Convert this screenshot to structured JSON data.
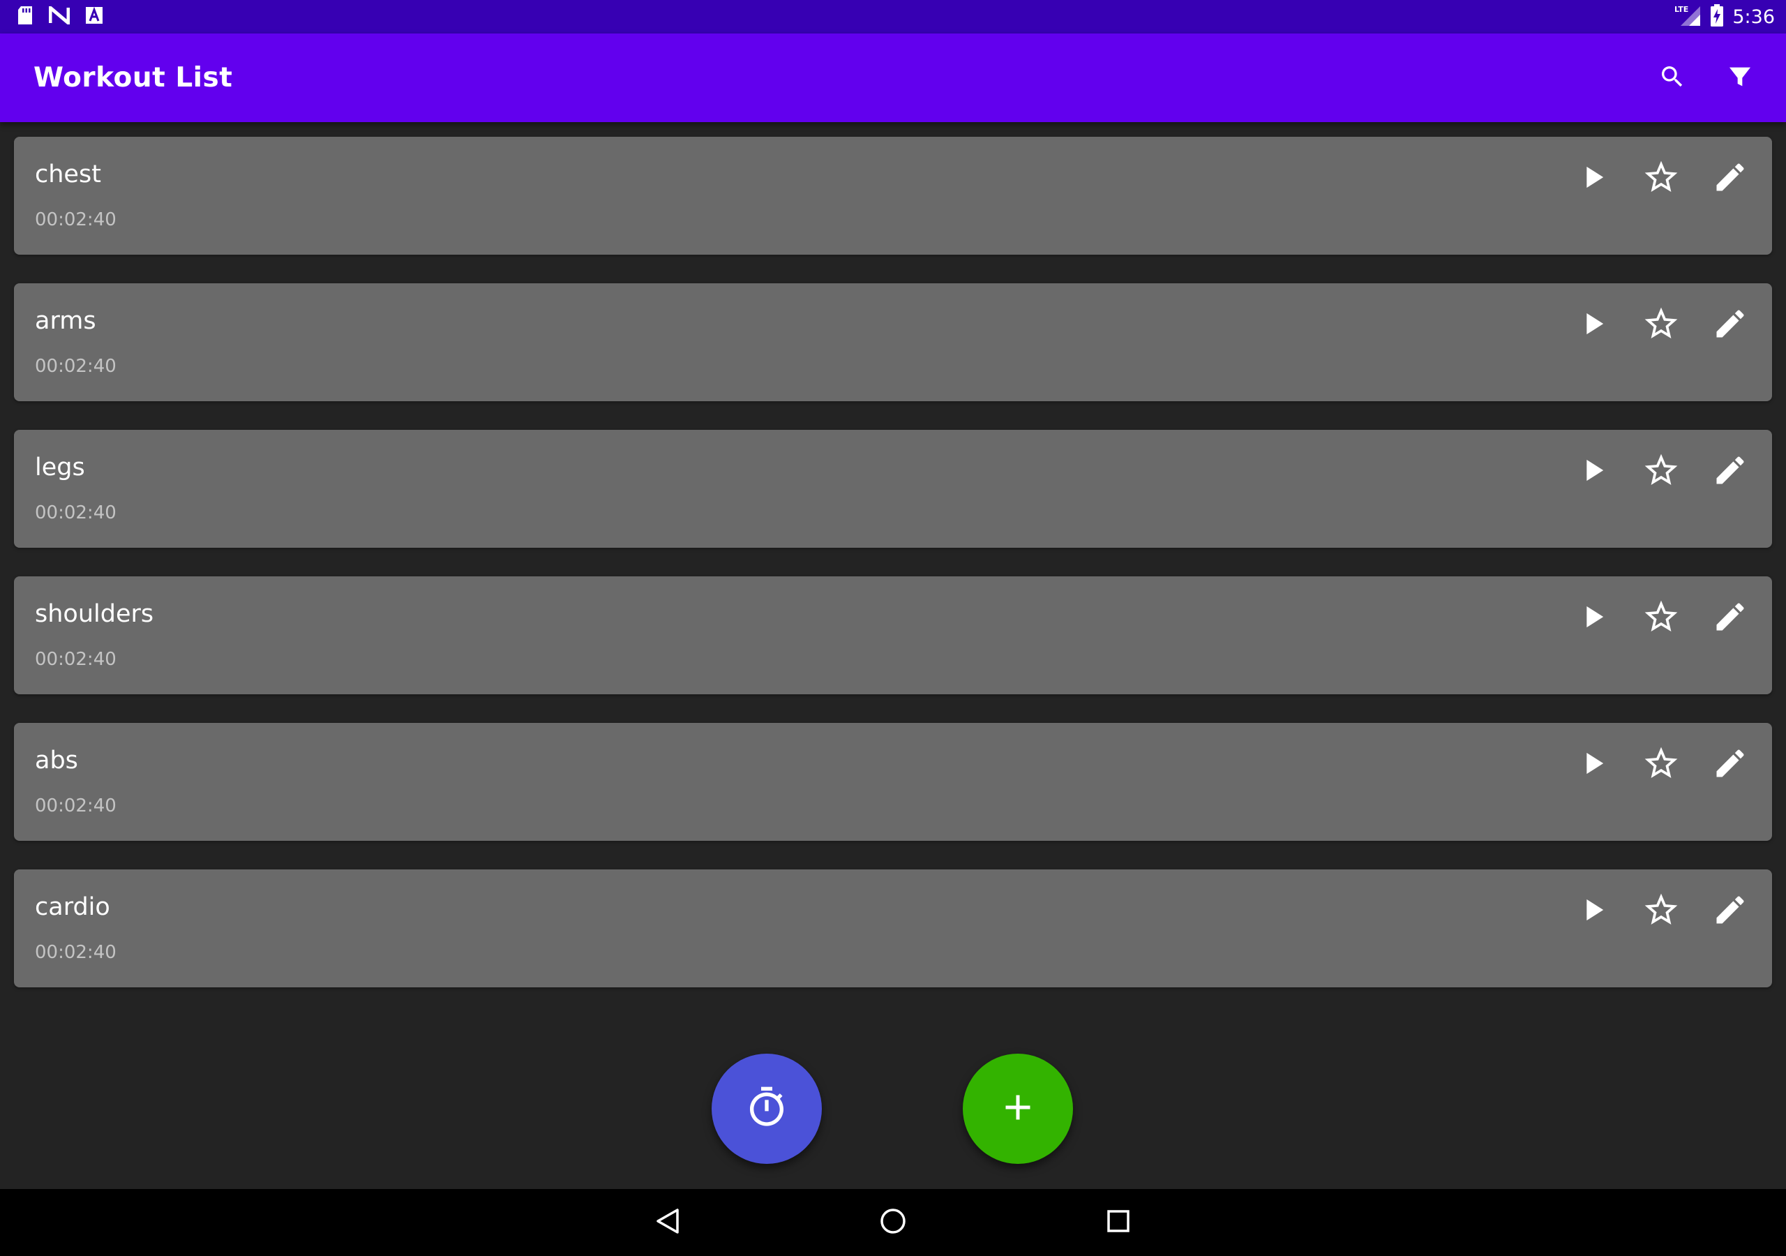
{
  "status_bar": {
    "time": "5:36",
    "network_label": "LTE",
    "left_icons": [
      "sd-card-icon",
      "n-notification-icon",
      "a-notification-icon"
    ],
    "right_icons": [
      "lte-signal-icon",
      "battery-charging-icon"
    ]
  },
  "app_bar": {
    "title": "Workout List",
    "actions": [
      "search-icon",
      "filter-icon"
    ]
  },
  "workouts": [
    {
      "name": "chest",
      "duration": "00:02:40"
    },
    {
      "name": "arms",
      "duration": "00:02:40"
    },
    {
      "name": "legs",
      "duration": "00:02:40"
    },
    {
      "name": "shoulders",
      "duration": "00:02:40"
    },
    {
      "name": "abs",
      "duration": "00:02:40"
    },
    {
      "name": "cardio",
      "duration": "00:02:40"
    }
  ],
  "row_actions": [
    "play-icon",
    "star-outline-icon",
    "pencil-icon"
  ],
  "fabs": [
    {
      "icon": "timer-icon",
      "color": "#4b52d8"
    },
    {
      "icon": "plus-icon",
      "color": "#33b300"
    }
  ],
  "nav_bar": [
    "back-triangle-icon",
    "home-circle-icon",
    "recents-square-icon"
  ],
  "colors": {
    "status_bar": "#3700b3",
    "app_bar": "#6200ee",
    "background": "#232323",
    "card": "#6a6a6a",
    "card_subtext": "#c4c4c4"
  }
}
